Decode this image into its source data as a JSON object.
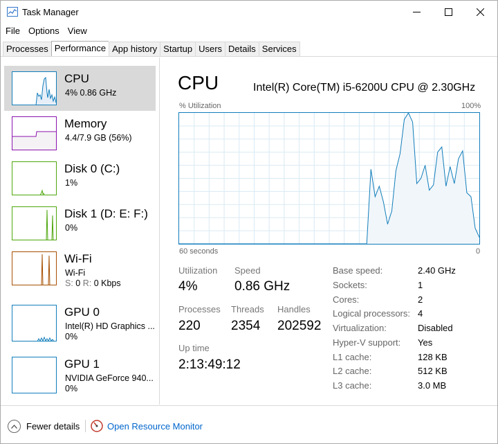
{
  "window": {
    "title": "Task Manager"
  },
  "menu": [
    "File",
    "Options",
    "View"
  ],
  "tabs": [
    "Processes",
    "Performance",
    "App history",
    "Startup",
    "Users",
    "Details",
    "Services"
  ],
  "active_tab": "Performance",
  "sidebar": {
    "items": [
      {
        "name": "CPU",
        "sub": "4%  0.86 GHz",
        "sub2": "",
        "color": "#117dbb",
        "selected": true
      },
      {
        "name": "Memory",
        "sub": "4.4/7.9 GB (56%)",
        "sub2": "",
        "color": "#8b12ae"
      },
      {
        "name": "Disk 0 (C:)",
        "sub": "1%",
        "sub2": "",
        "color": "#4da60c"
      },
      {
        "name": "Disk 1 (D: E: F:)",
        "sub": "0%",
        "sub2": "",
        "color": "#4da60c"
      },
      {
        "name": "Wi-Fi",
        "sub": "Wi-Fi",
        "sub2": "S: 0  R: 0 Kbps",
        "color": "#a74f01"
      },
      {
        "name": "GPU 0",
        "sub": "Intel(R) HD Graphics ...",
        "sub2": "0%",
        "color": "#117dbb"
      },
      {
        "name": "GPU 1",
        "sub": "NVIDIA GeForce 940...",
        "sub2": "0%",
        "color": "#117dbb"
      }
    ]
  },
  "main": {
    "title": "CPU",
    "model": "Intel(R) Core(TM) i5-6200U CPU @ 2.30GHz",
    "graph_label_left": "% Utilization",
    "graph_label_right": "100%",
    "graph_bottom_left": "60 seconds",
    "graph_bottom_right": "0",
    "graph_color": "#117dbb",
    "utilization_series": [
      0,
      0,
      0,
      0,
      0,
      0,
      0,
      0,
      0,
      0,
      0,
      0,
      0,
      0,
      0,
      0,
      0,
      0,
      0,
      0,
      0,
      0,
      0,
      0,
      0,
      0,
      0,
      0,
      0,
      0,
      0,
      0,
      0,
      0,
      0,
      0,
      0,
      0,
      0,
      0,
      0,
      0,
      0,
      0,
      0,
      0,
      57,
      36,
      44,
      32,
      15,
      25,
      56,
      69,
      95,
      100,
      93,
      46,
      50,
      60,
      41,
      45,
      70,
      74,
      44,
      59,
      46,
      65,
      71,
      39,
      36,
      12,
      5
    ],
    "stats": {
      "utilization_label": "Utilization",
      "utilization": "4%",
      "speed_label": "Speed",
      "speed": "0.86 GHz",
      "processes_label": "Processes",
      "processes": "220",
      "threads_label": "Threads",
      "threads": "2354",
      "handles_label": "Handles",
      "handles": "202592",
      "uptime_label": "Up time",
      "uptime": "2:13:49:12"
    },
    "specs": [
      {
        "label": "Base speed:",
        "value": "2.40 GHz"
      },
      {
        "label": "Sockets:",
        "value": "1"
      },
      {
        "label": "Cores:",
        "value": "2"
      },
      {
        "label": "Logical processors:",
        "value": "4"
      },
      {
        "label": "Virtualization:",
        "value": "Disabled"
      },
      {
        "label": "Hyper-V support:",
        "value": "Yes"
      },
      {
        "label": "L1 cache:",
        "value": "128 KB"
      },
      {
        "label": "L2 cache:",
        "value": "512 KB"
      },
      {
        "label": "L3 cache:",
        "value": "3.0 MB"
      }
    ]
  },
  "footer": {
    "fewer_details": "Fewer details",
    "open_resmon": "Open Resource Monitor"
  }
}
